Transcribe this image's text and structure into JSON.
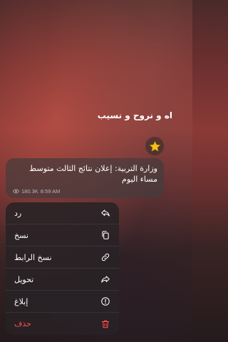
{
  "chat": {
    "sender_line": "اه و نروح و نسيب",
    "message_text": "وزارة التربية: إعلان نتائج الثالث متوسط مساء اليوم",
    "views": "180.3K",
    "time": "8:59 AM",
    "reaction_icon": "star-icon"
  },
  "menu": {
    "reply": "رد",
    "copy": "نسخ",
    "copy_link": "نسخ الرابط",
    "forward": "تحويل",
    "report": "إبلاغ",
    "delete": "حذف"
  },
  "colors": {
    "danger": "#ff4d4d",
    "star": "#f5c21b"
  }
}
